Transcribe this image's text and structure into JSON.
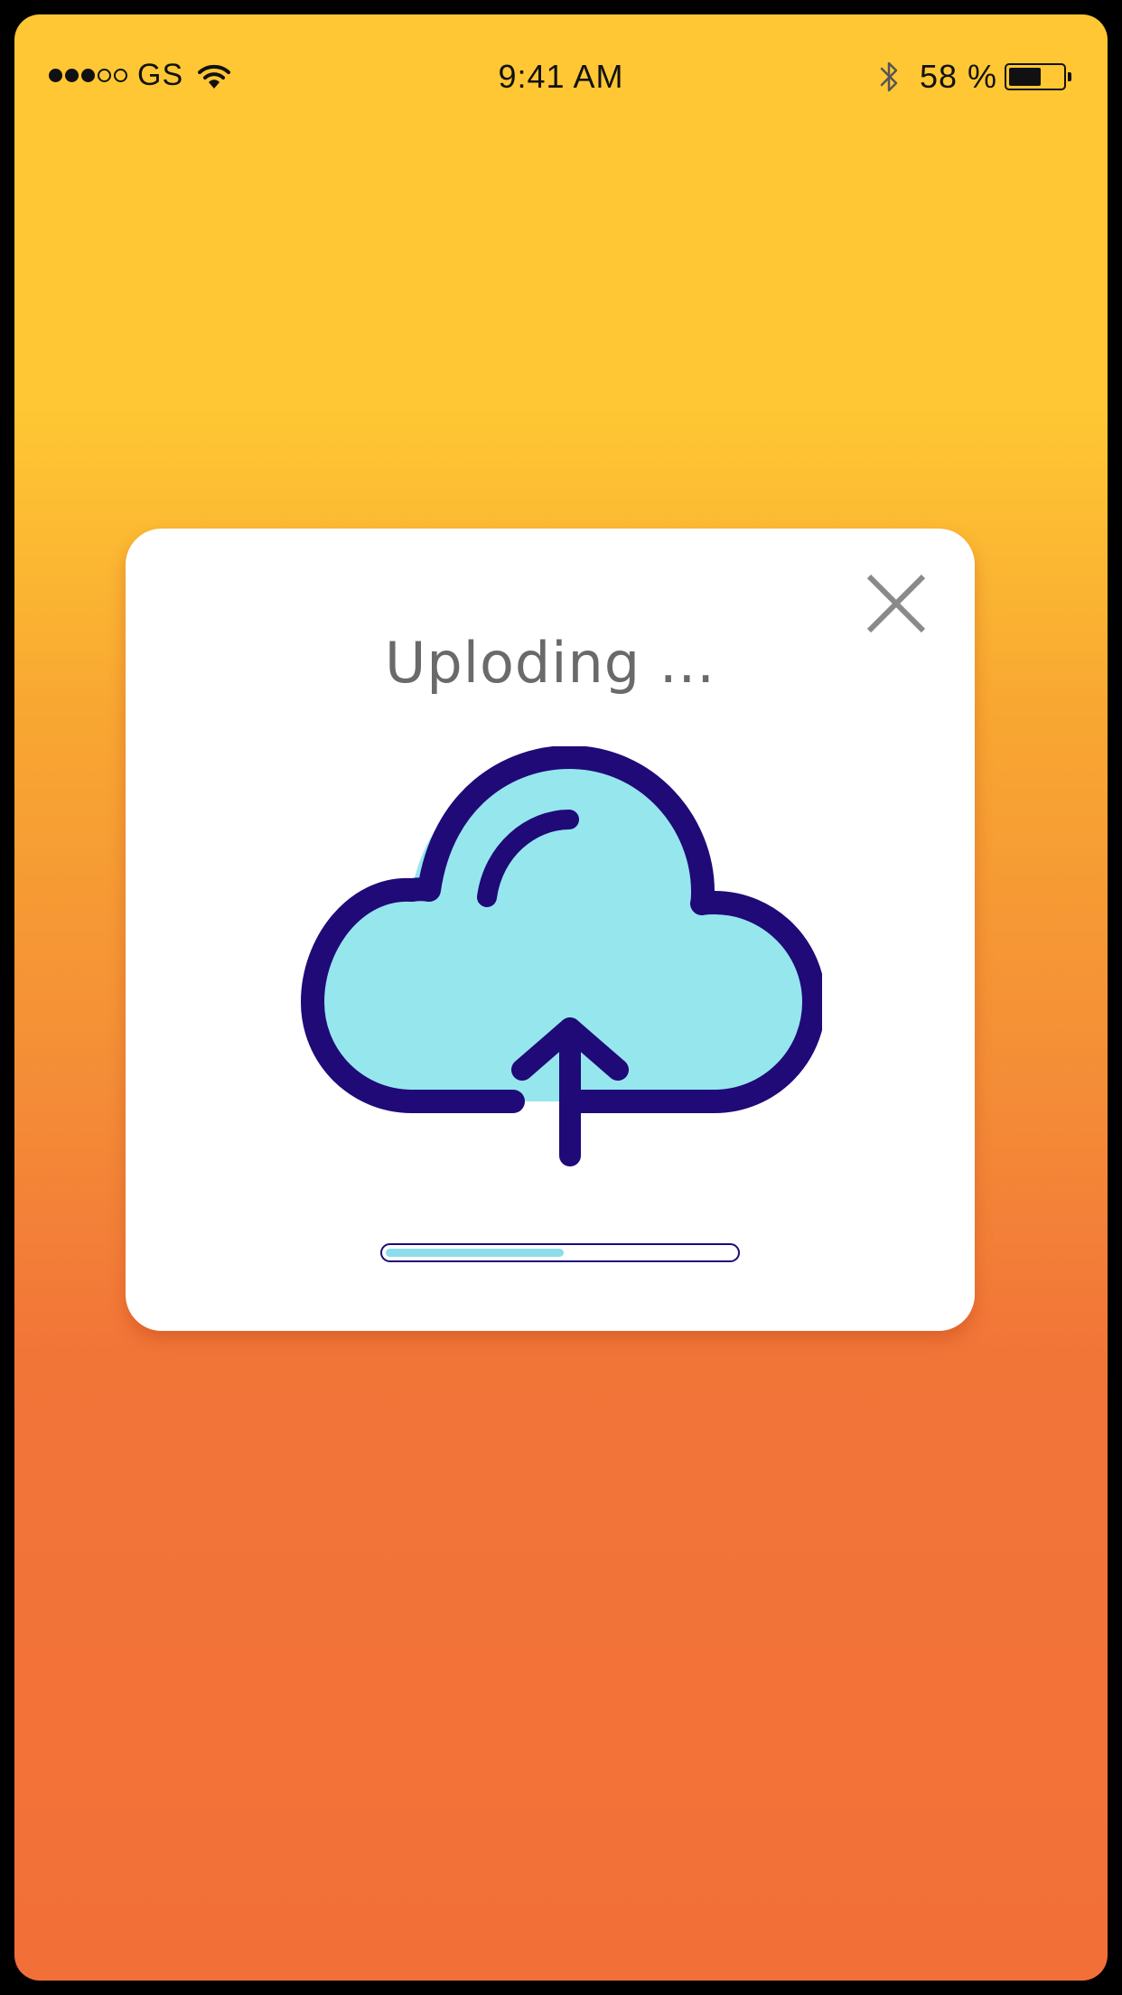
{
  "status_bar": {
    "signal_filled": 3,
    "signal_total": 5,
    "carrier": "GS",
    "time": "9:41 AM",
    "battery_percent_label": "58 %",
    "battery_level": 0.58,
    "icons": [
      "signal-dots-icon",
      "wifi-icon",
      "bluetooth-icon",
      "battery-icon"
    ]
  },
  "upload_dialog": {
    "title": "Uploding ...",
    "close_icon": "close-icon",
    "illustration_icon": "cloud-upload-icon",
    "progress": 0.52
  },
  "colors": {
    "background_top": "#FFC733",
    "background_bottom": "#F27038",
    "dialog_background": "#FFFFFF",
    "icon_stroke": "#1F0A78",
    "icon_fill": "#96E6EE",
    "progress_fill": "#8DDCEB",
    "title_text": "#6A6A6A",
    "close_icon": "#8A8A8A"
  }
}
